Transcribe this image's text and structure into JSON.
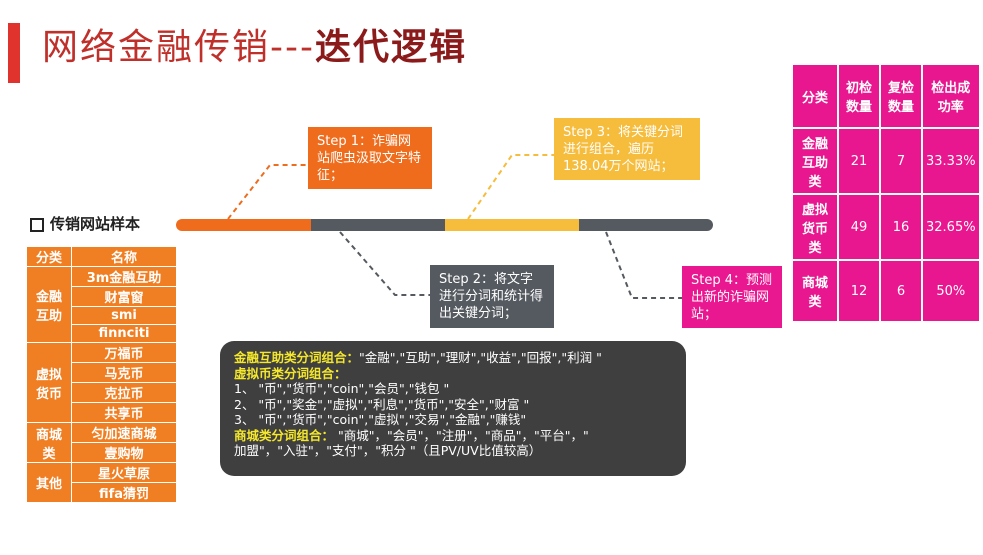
{
  "title": {
    "part1": "网络金融传销---",
    "part2": "迭代逻辑"
  },
  "sample_label": "传销网站样本",
  "colors": {
    "orange": "#ef6c1d",
    "yellow": "#f6bc3c",
    "gray": "#555a60",
    "pink": "#ea1890",
    "dark": "#3f3f3f"
  },
  "steps": {
    "step1": "Step 1：诈骗网站爬虫汲取文字特征；",
    "step2": "Step 2：将文字进行分词和统计得出关键分词；",
    "step3": "Step 3：将关键分词进行组合，遍历138.04万个网站；",
    "step4": "Step 4：预测出新的诈骗网站；"
  },
  "left_table": {
    "header": [
      "分类",
      "名称"
    ],
    "groups": [
      {
        "category": "金融互助",
        "names": [
          "3m金融互助",
          "财富窗",
          "smi",
          "finnciti"
        ]
      },
      {
        "category": "虚拟货币",
        "names": [
          "万福币",
          "马克币",
          "克拉币",
          "共享币"
        ]
      },
      {
        "category": "商城类",
        "names": [
          "匀加速商城",
          "壹购物"
        ]
      },
      {
        "category": "其他",
        "names": [
          "星火草原",
          "fifa猜罚"
        ]
      }
    ]
  },
  "right_table": {
    "header": [
      "分类",
      "初检数量",
      "复检数量",
      "检出成功率"
    ],
    "rows": [
      [
        "金融互助类",
        "21",
        "7",
        "33.33%"
      ],
      [
        "虚拟货币类",
        "49",
        "16",
        "32.65%"
      ],
      [
        "商城类",
        "12",
        "6",
        "50%"
      ]
    ]
  },
  "combos": {
    "finance_title": "金融互助类分词组合：",
    "finance_text": "\"金融\",\"互助\",\"理财\",\"收益\",\"回报\",\"利润 \"",
    "crypto_title": "虚拟币类分词组合：",
    "crypto_lines": [
      "1、 \"币\",\"货币\",\"coin\",\"会员\",\"钱包 \"",
      "2、 \"币\",\"奖金\",\"虚拟\",\"利息\",\"货币\",\"安全\",\"财富 \"",
      "3、 \"币\",\"货币\",\"coin\",\"虚拟\",\"交易\",\"金融\",\"赚钱\""
    ],
    "mall_title": "商城类分词组合：",
    "mall_text1": " \"商城\"，\"会员\"，\"注册\"，\"商品\"，\"平台\"，\"",
    "mall_text2": "加盟\"，\"入驻\"，\"支付\"，\"积分 \"（且PV/UV比值较高）"
  }
}
